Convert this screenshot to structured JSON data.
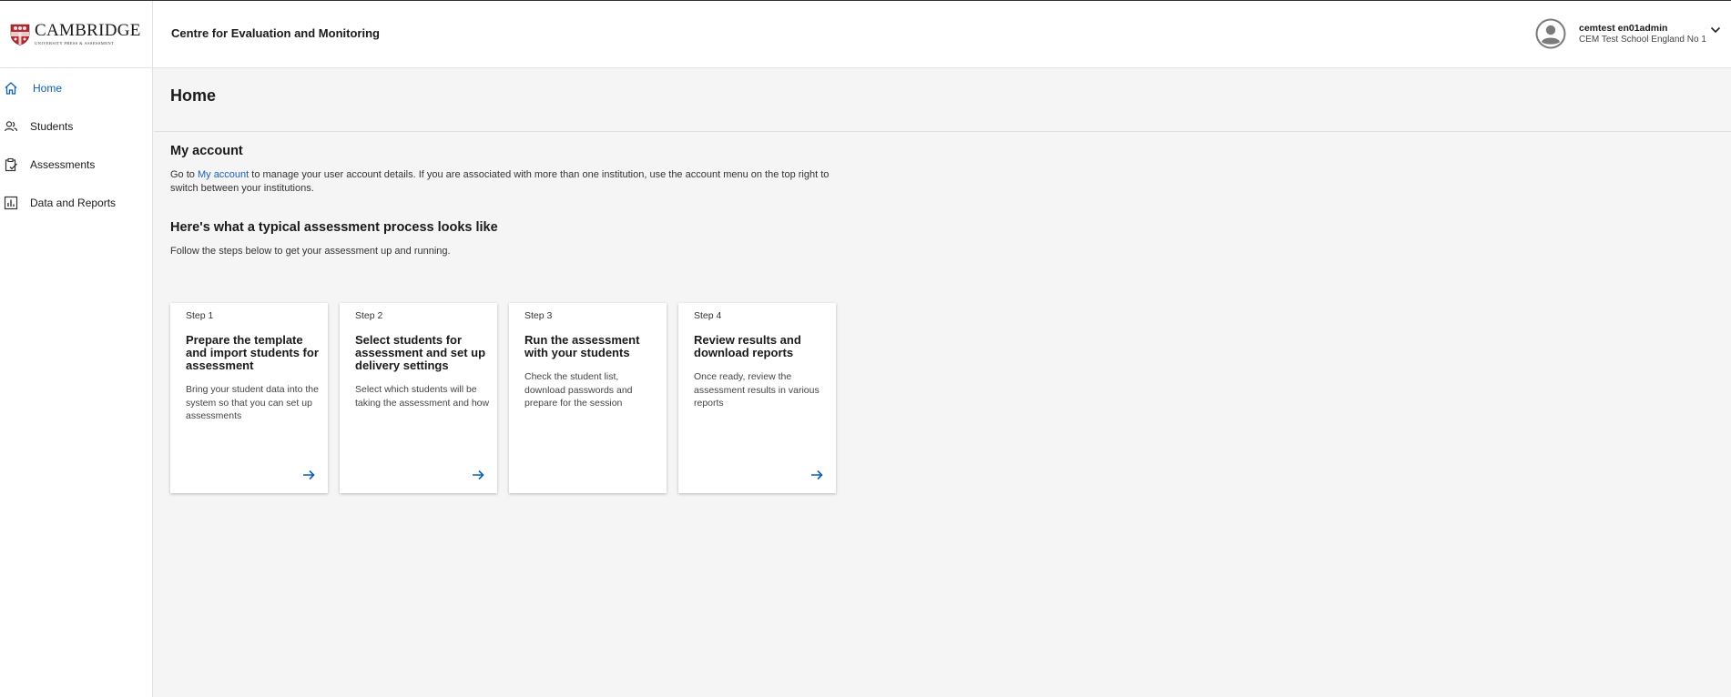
{
  "header": {
    "logo_name": "CAMBRIDGE",
    "logo_sub": "UNIVERSITY PRESS & ASSESSMENT",
    "app_title": "Centre for Evaluation and Monitoring",
    "user_name": "cemtest en01admin",
    "user_school": "CEM Test School England No 1",
    "avatar_icon": "user-avatar-icon",
    "menu_icon": "chevron-down-icon"
  },
  "sidebar": {
    "items": [
      {
        "label": "Home",
        "icon": "home-icon",
        "active": true
      },
      {
        "label": "Students",
        "icon": "people-icon",
        "active": false
      },
      {
        "label": "Assessments",
        "icon": "clipboard-check-icon",
        "active": false
      },
      {
        "label": "Data and Reports",
        "icon": "bar-chart-icon",
        "active": false
      }
    ]
  },
  "main": {
    "page_title": "Home",
    "account": {
      "title": "My account",
      "text_before": "Go to ",
      "link": "My account",
      "text_after": " to manage your user account details. If you are associated with more than one institution, use the account menu on the top right to switch between your institutions."
    },
    "process": {
      "title": "Here's what a typical assessment process looks like",
      "subtitle": "Follow the steps below to get your assessment up and running."
    },
    "cards": [
      {
        "step": "Step 1",
        "title": "Prepare the template and import students for assessment",
        "desc": "Bring your student data into the system so that you can set up assessments",
        "has_arrow": true
      },
      {
        "step": "Step 2",
        "title": "Select students for assessment and set up delivery settings",
        "desc": "Select which students will be taking the assessment and how",
        "has_arrow": true
      },
      {
        "step": "Step 3",
        "title": "Run the assessment with your students",
        "desc": "Check the student list, download passwords and prepare for the session",
        "has_arrow": false
      },
      {
        "step": "Step 4",
        "title": "Review results and download reports",
        "desc": "Once ready, review the assessment results in various reports",
        "has_arrow": true
      }
    ]
  },
  "colors": {
    "accent": "#0b5fb4",
    "link": "#1b5fbf",
    "logo_red": "#b5292f",
    "background": "#f5f5f5"
  }
}
